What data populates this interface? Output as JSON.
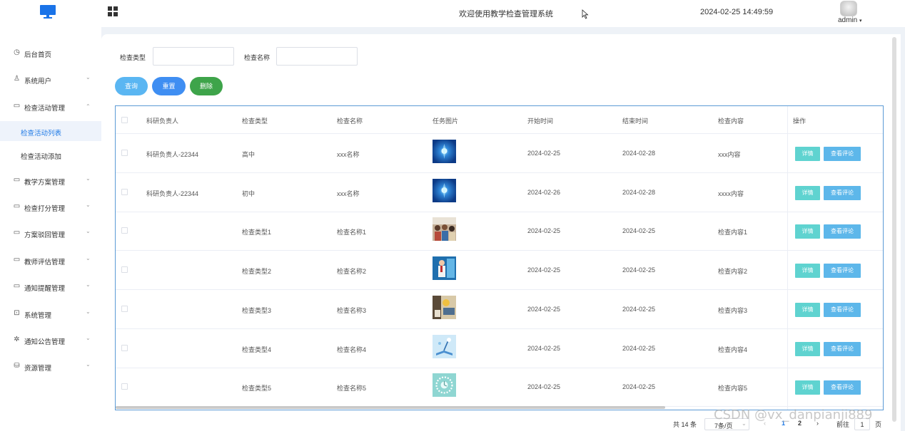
{
  "header": {
    "title": "欢迎使用教学检查管理系统",
    "datetime": "2024-02-25 14:49:59",
    "user": "admin"
  },
  "sidebar": {
    "items": [
      {
        "label": "后台首页",
        "icon": "clock-icon",
        "arrow": ""
      },
      {
        "label": "系统用户",
        "icon": "user-icon",
        "arrow": "⌄"
      },
      {
        "label": "检查活动管理",
        "icon": "card-icon",
        "arrow": "⌃"
      },
      {
        "label": "检查活动列表",
        "sub": true,
        "active": true
      },
      {
        "label": "检查活动添加",
        "sub": true,
        "active": false
      },
      {
        "label": "教学方案管理",
        "icon": "card-icon",
        "arrow": "⌄"
      },
      {
        "label": "检查打分管理",
        "icon": "card-icon",
        "arrow": "⌄"
      },
      {
        "label": "方案驳回管理",
        "icon": "card-icon",
        "arrow": "⌄"
      },
      {
        "label": "教师评估管理",
        "icon": "card-icon",
        "arrow": "⌄"
      },
      {
        "label": "通知提醒管理",
        "icon": "card-icon",
        "arrow": "⌄"
      },
      {
        "label": "系统管理",
        "icon": "folder-icon",
        "arrow": "⌄"
      },
      {
        "label": "通知公告管理",
        "icon": "sparkle-icon",
        "arrow": "⌄"
      },
      {
        "label": "资源管理",
        "icon": "cube-icon",
        "arrow": "⌄"
      }
    ]
  },
  "filters": {
    "type_label": "检查类型",
    "type_value": "",
    "name_label": "检查名称",
    "name_value": ""
  },
  "buttons": {
    "query": "查询",
    "reset": "重置",
    "delete": "删除"
  },
  "table": {
    "headers": [
      "科研负责人",
      "检查类型",
      "检查名称",
      "任务图片",
      "开始时间",
      "结束时间",
      "检查内容",
      "操作"
    ],
    "rows": [
      {
        "leader": "科研负责人-22344",
        "type": "高中",
        "name": "xxx名称",
        "start": "2024-02-25",
        "end": "2024-02-28",
        "content": "xxx内容",
        "img": "blue-tech"
      },
      {
        "leader": "科研负责人-22344",
        "type": "初中",
        "name": "xxx名称",
        "start": "2024-02-26",
        "end": "2024-02-28",
        "content": "xxxx内容",
        "img": "blue-tech"
      },
      {
        "leader": "",
        "type": "检查类型1",
        "name": "检查名称1",
        "start": "2024-02-25",
        "end": "2024-02-25",
        "content": "检查内容1",
        "img": "classroom"
      },
      {
        "leader": "",
        "type": "检查类型2",
        "name": "检查名称2",
        "start": "2024-02-25",
        "end": "2024-02-25",
        "content": "检查内容2",
        "img": "presenter"
      },
      {
        "leader": "",
        "type": "检查类型3",
        "name": "检查名称3",
        "start": "2024-02-25",
        "end": "2024-02-25",
        "content": "检查内容3",
        "img": "study"
      },
      {
        "leader": "",
        "type": "检查类型4",
        "name": "检查名称4",
        "start": "2024-02-25",
        "end": "2024-02-25",
        "content": "检查内容4",
        "img": "book-light"
      },
      {
        "leader": "",
        "type": "检查类型5",
        "name": "检查名称5",
        "start": "2024-02-25",
        "end": "2024-02-25",
        "content": "检查内容5",
        "img": "clock-teal"
      }
    ],
    "detail_btn": "详情",
    "review_btn": "查看评论"
  },
  "pagination": {
    "total": "共 14 条",
    "page_size": "7条/页",
    "prev": "‹",
    "page1": "1",
    "page2": "2",
    "next": "›",
    "goto": "前往",
    "current": "1",
    "page_suffix": "页"
  },
  "watermark": "CSDN @vx_danpianji889",
  "colors": {
    "accent": "#1f7ae6",
    "query_btn": "#5ab6f2",
    "reset_btn": "#3f8ef2",
    "delete_btn": "#3ea44a",
    "detail_btn": "#5fd3d0",
    "review_btn": "#5db7ea"
  }
}
